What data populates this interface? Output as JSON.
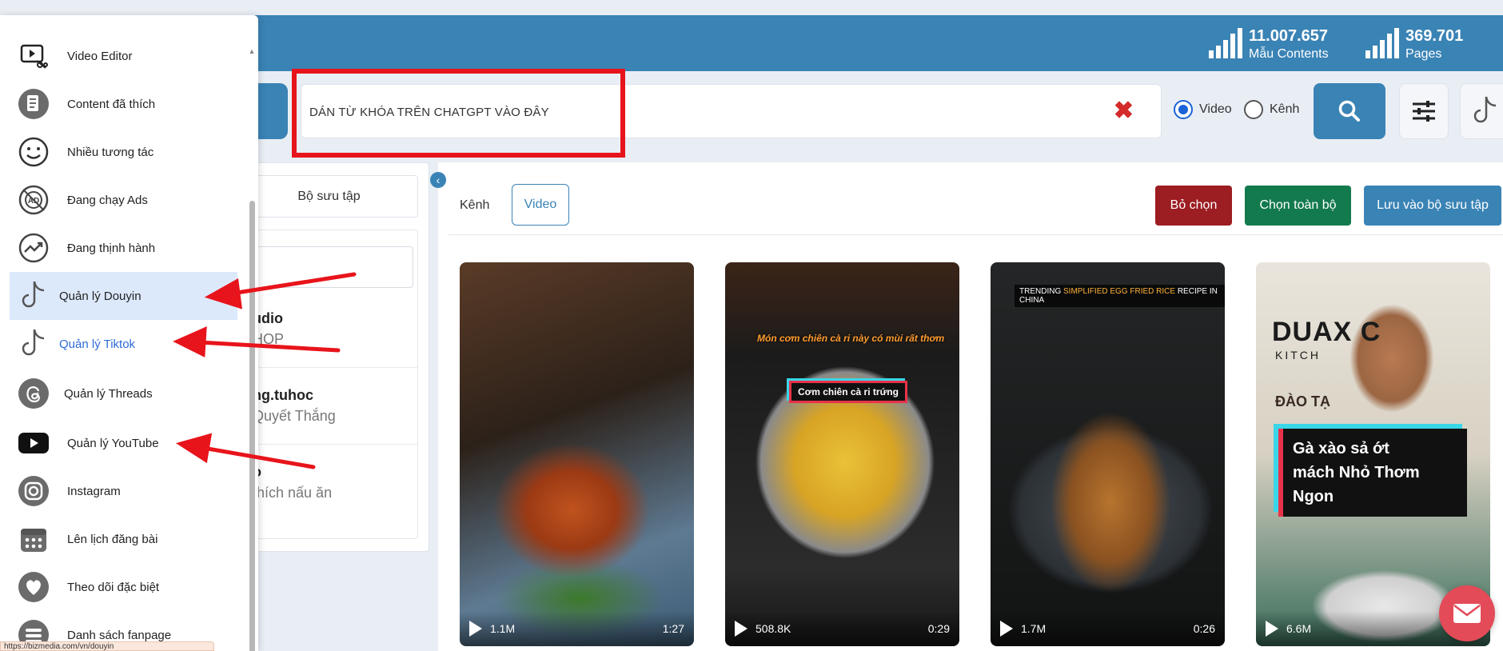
{
  "header": {
    "stats": [
      {
        "value": "11.007.657",
        "label": "Mẫu Contents"
      },
      {
        "value": "369.701",
        "label": "Pages"
      }
    ]
  },
  "search": {
    "value": "DÁN TỪ KHÓA TRÊN CHATGPT VÀO ĐÂY",
    "clear_glyph": "✖",
    "radio_options": [
      {
        "label": "Video",
        "checked": true
      },
      {
        "label": "Kênh",
        "checked": false
      }
    ]
  },
  "sidebar": {
    "items": [
      {
        "label": "Video Editor",
        "icon": "video-editor-icon"
      },
      {
        "label": "Content đã thích",
        "icon": "document-icon"
      },
      {
        "label": "Nhiều tương tác",
        "icon": "smile-icon"
      },
      {
        "label": "Đang chạy Ads",
        "icon": "ad-icon"
      },
      {
        "label": "Đang thịnh hành",
        "icon": "trending-icon"
      },
      {
        "label": "Quản lý Douyin",
        "icon": "douyin-icon",
        "active": true
      },
      {
        "label": "Quản lý Tiktok",
        "icon": "tiktok-icon"
      },
      {
        "label": "Quản lý Threads",
        "icon": "threads-icon"
      },
      {
        "label": "Quản lý YouTube",
        "icon": "youtube-icon"
      },
      {
        "label": "Instagram",
        "icon": "instagram-icon"
      },
      {
        "label": "Lên lịch đăng bài",
        "icon": "calendar-icon"
      },
      {
        "label": "Theo dõi đặc biệt",
        "icon": "heart-icon"
      },
      {
        "label": "Danh sách fanpage",
        "icon": "list-icon"
      }
    ],
    "status_url": "https://bizmedia.com/vn/douyin"
  },
  "middle_panel": {
    "collection_tab": "Bộ sưu tập",
    "items": [
      {
        "title": "udio",
        "subtitle": "HOP"
      },
      {
        "title": "ng.tuhoc",
        "subtitle": "Quyết Thắng"
      },
      {
        "title": "o",
        "subtitle": "thích nấu ăn"
      }
    ]
  },
  "content": {
    "tabs": [
      "Kênh",
      "Video"
    ],
    "active_tab": "Video",
    "actions": {
      "deselect": "Bỏ chọn",
      "select_all": "Chọn toàn bộ",
      "save_collection": "Lưu vào bộ sưu tập"
    },
    "videos": [
      {
        "views": "1.1M",
        "duration": "1:27",
        "captions": []
      },
      {
        "views": "508.8K",
        "duration": "0:29",
        "captions": [
          "Món cơm chiên cà ri này có mùi rất thơm",
          "Cơm chiên cà ri trứng"
        ]
      },
      {
        "views": "1.7M",
        "duration": "0:26",
        "captions": [
          "TRENDING",
          "SIMPLIFIED EGG FRIED RICE",
          "RECIPE IN CHINA"
        ]
      },
      {
        "views": "6.6M",
        "duration": "",
        "captions": [
          "Gà xào sả ớt",
          "mách Nhỏ Thơm Ngon",
          "DUAX C",
          "KITCH",
          "ĐÀO TẠ"
        ]
      }
    ]
  },
  "colors": {
    "primary": "#3a83b5",
    "danger": "#9c1d22",
    "success": "#137a4e",
    "annotation": "#e8141b"
  }
}
